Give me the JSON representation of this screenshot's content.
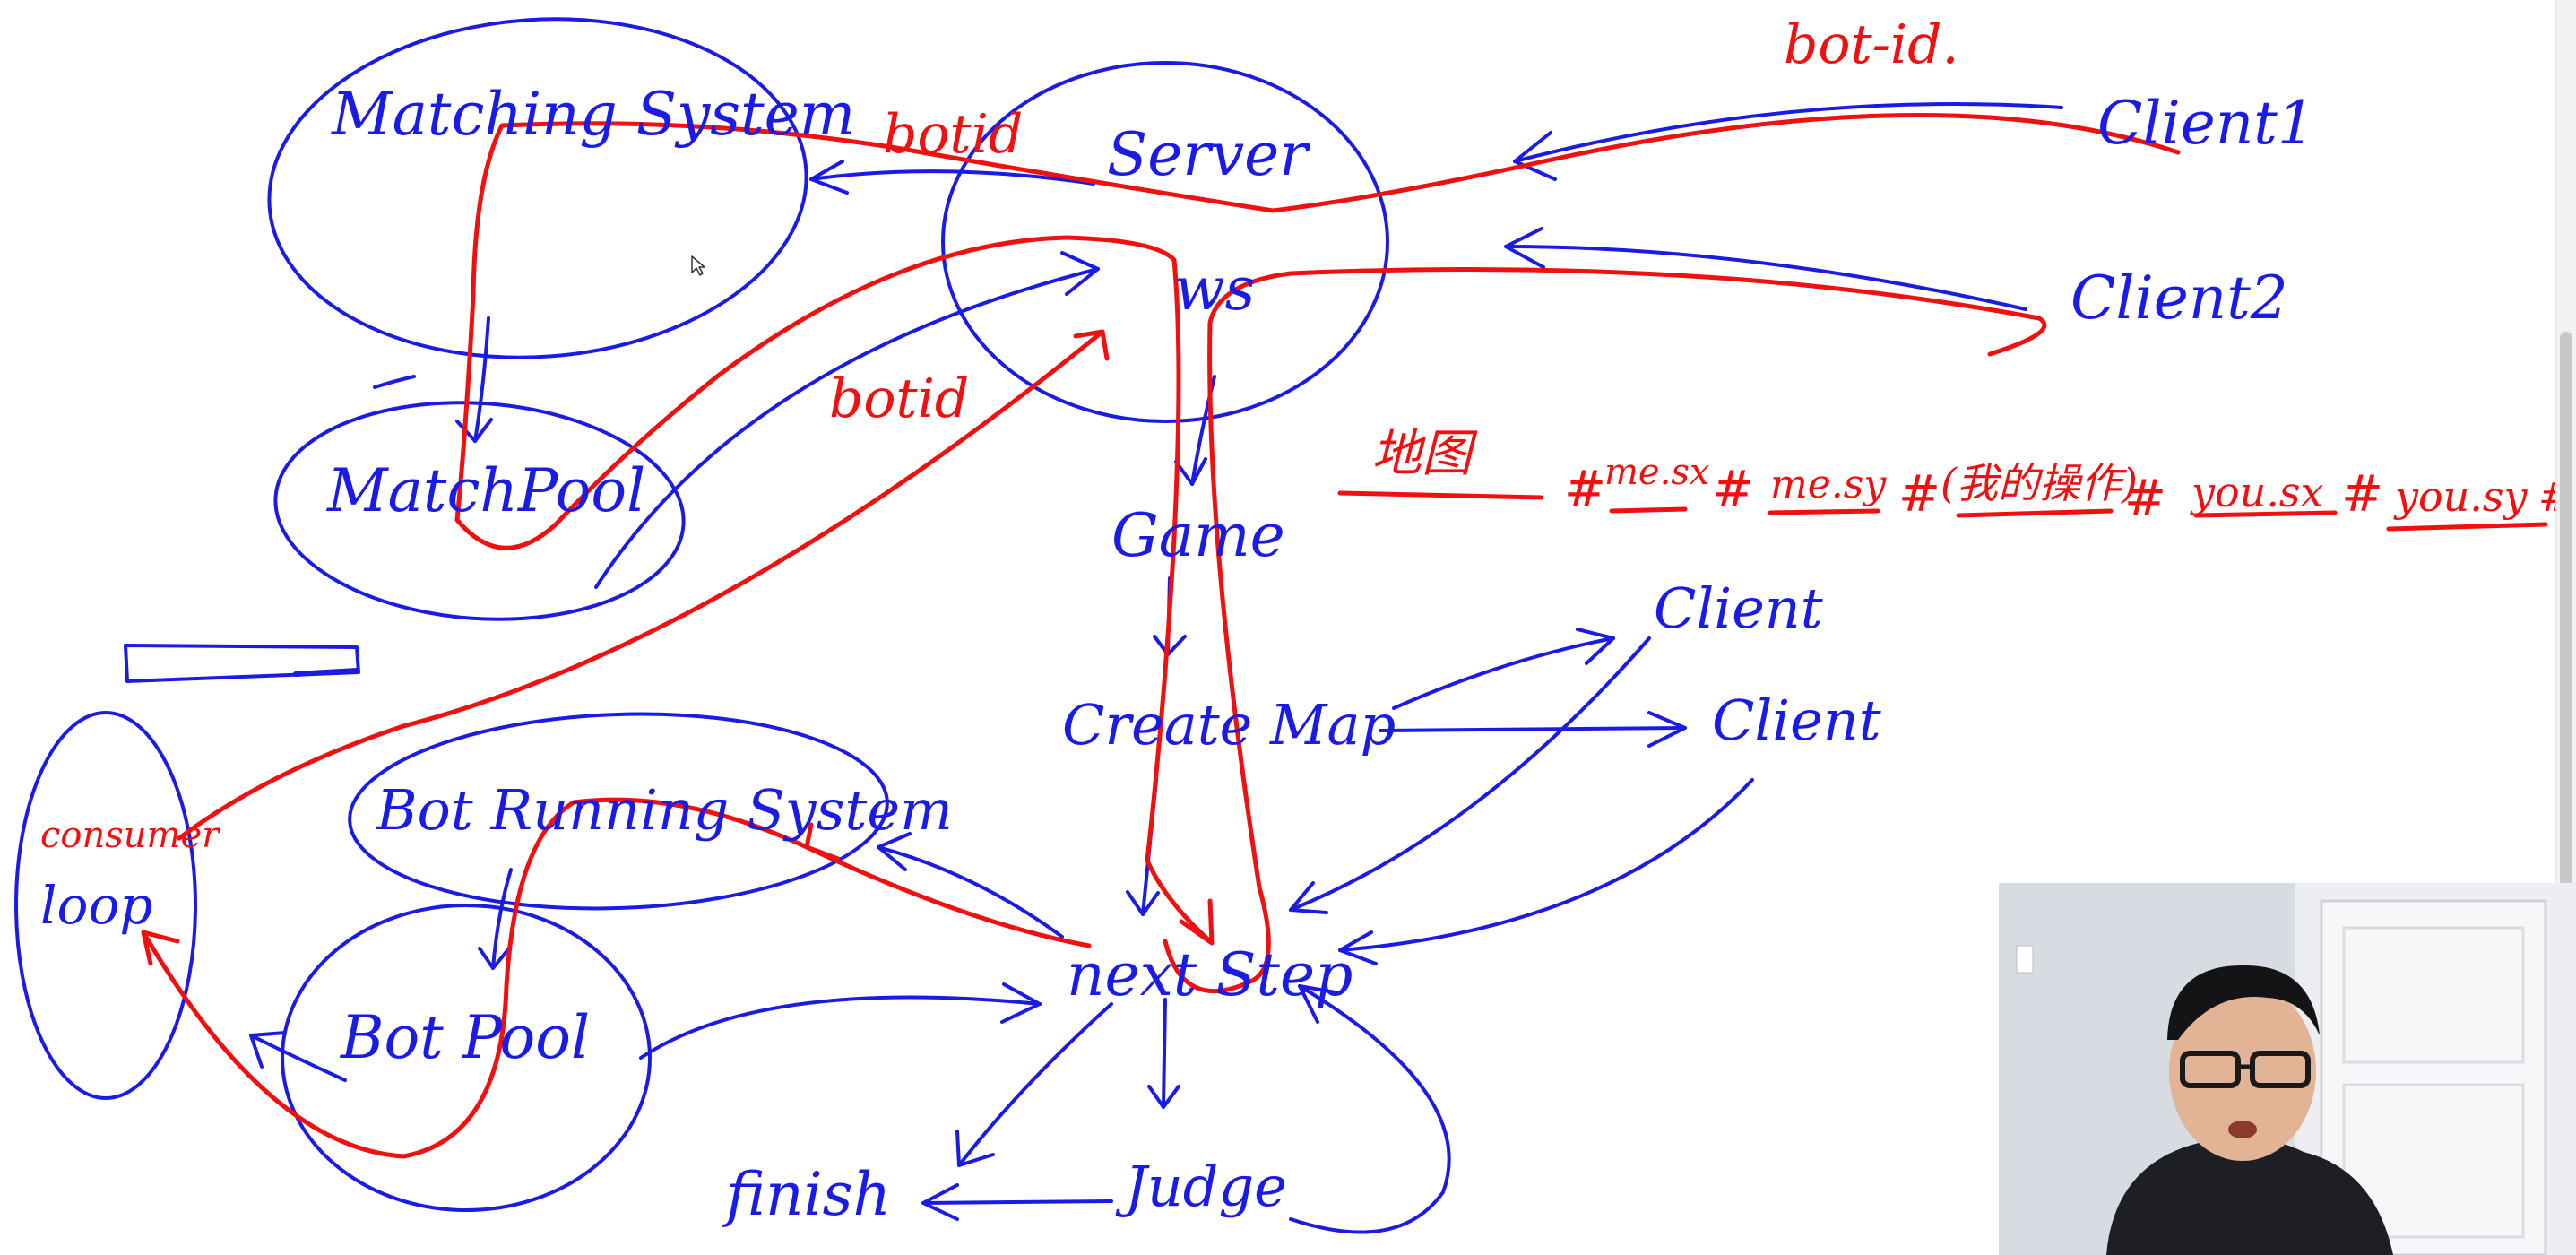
{
  "colors": {
    "ink_blue": "#1b1be6",
    "ink_red": "#f01010"
  },
  "labels": {
    "matching_system": "Matching System",
    "server": "Server",
    "ws": "ws",
    "match_pool": "MatchPool",
    "bot_running_system": "Bot Running System",
    "bot_pool": "Bot Pool",
    "consumer": "consumer",
    "loop": "loop",
    "game": "Game",
    "create_map": "Create Map",
    "next_step": "next Step",
    "judge": "Judge",
    "finish": "finish",
    "client_1": "Client1",
    "client_2": "Client2",
    "client_a": "Client",
    "client_b": "Client",
    "botid_top": "botid",
    "botid_mid": "botid",
    "bot_id_right": "bot-id.",
    "map_label": "地图",
    "payload_sep_1": "#",
    "me_sx": "me.sx",
    "payload_sep_2": "#",
    "me_sy": "me.sy",
    "payload_sep_3": "#",
    "my_ops": "(我的操作)",
    "payload_sep_4": "#",
    "you_sx": "you.sx",
    "payload_sep_5": "#",
    "you_sy": "you.sy",
    "payload_sep_6": "#"
  },
  "icons": {
    "cursor": "cursor-arrow-icon"
  }
}
